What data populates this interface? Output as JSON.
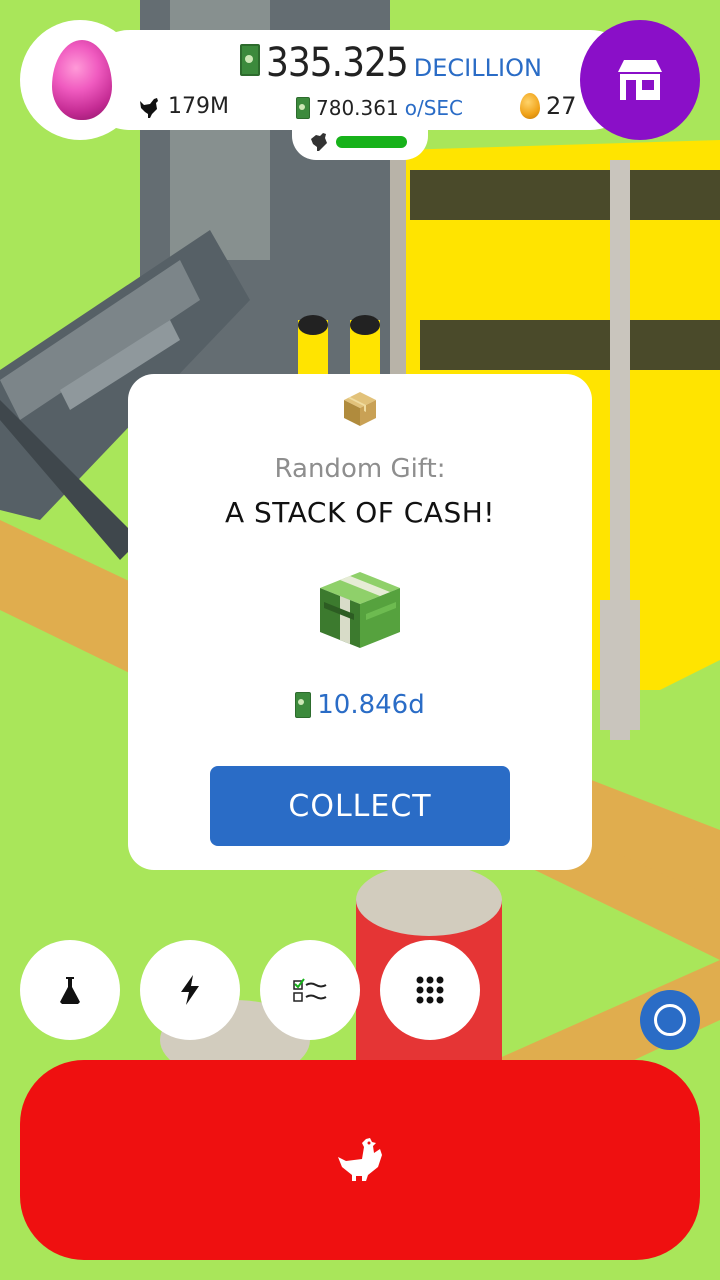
{
  "hud": {
    "cash_value": "335.325",
    "cash_unit": "DECILLION",
    "chicken_count": "179M",
    "earnings_rate": "780.361",
    "earnings_rate_unit": "o/SEC",
    "golden_eggs": "27",
    "hatchery_progress": 0.85,
    "icons": {
      "egg": "pink-egg-icon",
      "chicken": "chicken-icon",
      "cash": "cash-icon",
      "golden_egg": "golden-egg-icon",
      "shop": "shop-icon"
    }
  },
  "gift_dialog": {
    "label": "Random Gift:",
    "title": "A STACK OF CASH!",
    "reward_value": "10.846d",
    "collect_label": "COLLECT"
  },
  "toolbar": {
    "buttons": [
      "research-icon",
      "boost-icon",
      "missions-icon",
      "menu-grid-icon"
    ]
  },
  "colors": {
    "primary_blue": "#2a6cc6",
    "shop_purple": "#8a0fc8",
    "hatch_red": "#ef1010",
    "grass": "#a9e65a",
    "progress_green": "#17b21a"
  }
}
